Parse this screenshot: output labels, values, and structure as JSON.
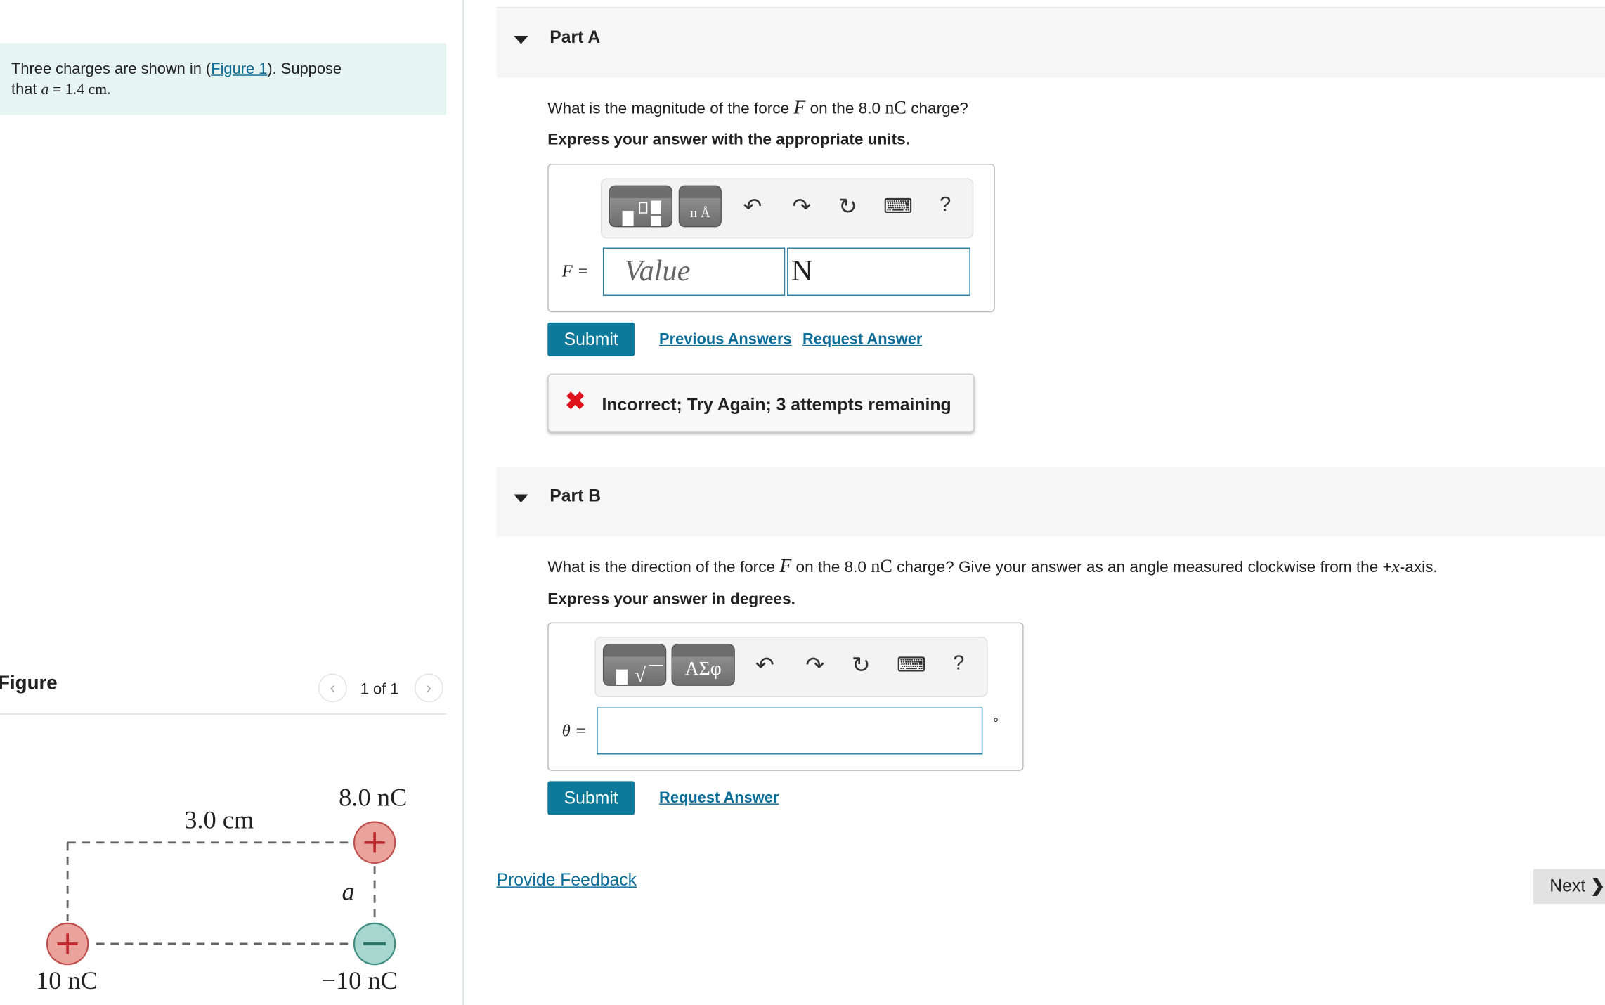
{
  "problem": {
    "text_before": "Three charges are shown in (",
    "figure_link": "Figure 1",
    "text_after": "). Suppose",
    "line2_prefix": "that ",
    "var": "a",
    "line2_rest": " = 1.4 cm."
  },
  "figure": {
    "title": "Figure",
    "pagination": "1 of 1",
    "labels": {
      "top_distance": "3.0 cm",
      "charge_top_right": "8.0 nC",
      "side": "a",
      "charge_bottom_left": "10 nC",
      "charge_bottom_right": "−10 nC"
    },
    "colors": {
      "positive": "#eaa39c",
      "negative": "#a7d6cf"
    }
  },
  "partA": {
    "title": "Part A",
    "question_pre": "What is the magnitude of the force ",
    "question_var": "F",
    "question_post1": " on the 8.0 ",
    "question_unit": "nC",
    "question_post2": " charge?",
    "instruction": "Express your answer with the appropriate units.",
    "label": "F =",
    "value_placeholder": "Value",
    "unit_value": "N",
    "submit": "Submit",
    "previous_answers": "Previous Answers",
    "request_answer": "Request Answer",
    "feedback": "Incorrect; Try Again; 3 attempts remaining",
    "toolbar": [
      "templates-icon",
      "symbols-icon",
      "undo-icon",
      "redo-icon",
      "reset-icon",
      "keyboard-icon",
      "help-icon"
    ]
  },
  "partB": {
    "title": "Part B",
    "question_pre": "What is the direction of the force ",
    "question_var": "F",
    "question_post1": " on the 8.0 ",
    "question_unit": "nC",
    "question_post2": " charge? Give your answer as an angle measured clockwise from the +",
    "question_axis": "x",
    "question_post3": "-axis.",
    "instruction": "Express your answer in degrees.",
    "label": "θ =",
    "degree": "°",
    "symbols_label": "ΑΣφ",
    "submit": "Submit",
    "request_answer": "Request Answer"
  },
  "footer": {
    "provide_feedback": "Provide Feedback",
    "next": "Next"
  },
  "colors": {
    "accent": "#0e7a9b",
    "link": "#0b6e99",
    "error": "#e0101a"
  }
}
